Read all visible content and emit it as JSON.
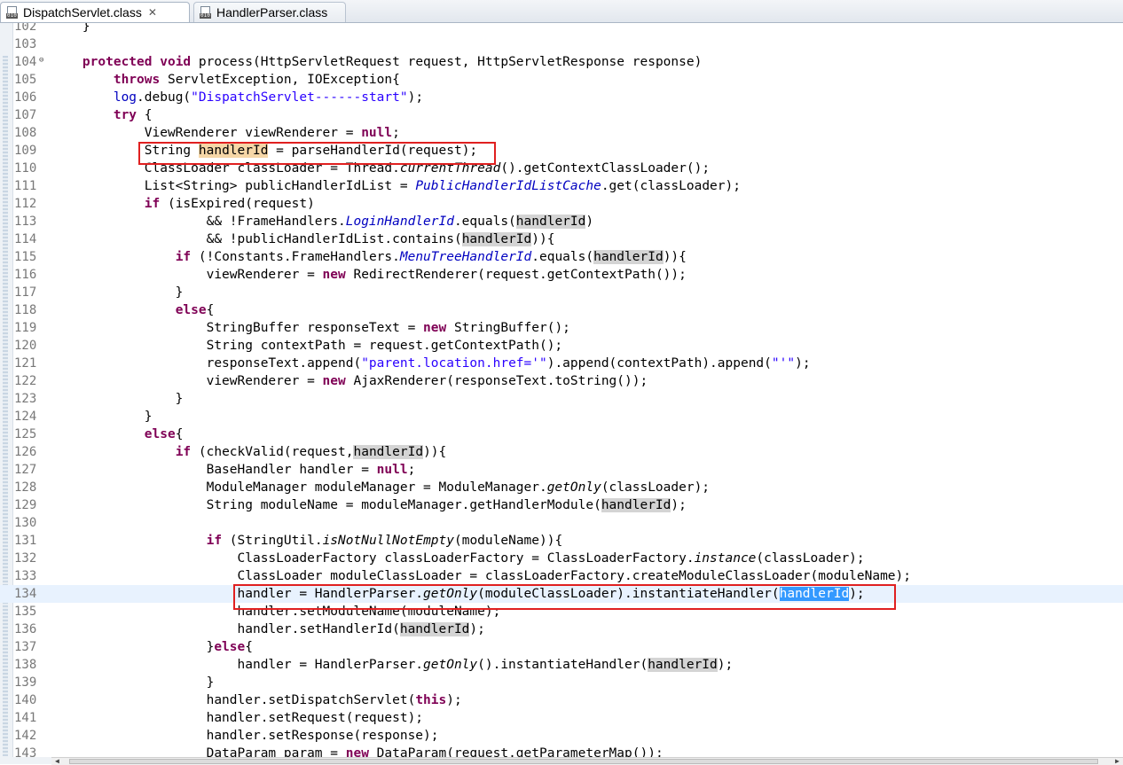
{
  "tabs": [
    {
      "label": "DispatchServlet.class",
      "icon": "class-file-icon",
      "close": "✕"
    },
    {
      "label": "HandlerParser.class",
      "icon": "class-file-icon"
    }
  ],
  "colors": {
    "keyword": "#7f0055",
    "string": "#2a00ff",
    "field": "#0000c0",
    "line_number": "#787878",
    "occurrence_highlight": "#d4d4d4",
    "declaration_highlight": "#f6d7a7",
    "selection": "#3399ff",
    "annotation_box": "#e02020"
  },
  "editor": {
    "lines": [
      {
        "n": "102",
        "segs": [
          [
            "    }",
            ""
          ]
        ]
      },
      {
        "n": "103",
        "segs": []
      },
      {
        "n": "104",
        "fold": true,
        "segs": [
          [
            "    ",
            ""
          ],
          [
            "protected",
            "kw"
          ],
          [
            " ",
            ""
          ],
          [
            "void",
            "kw"
          ],
          [
            " process(HttpServletRequest request, HttpServletResponse response)",
            ""
          ]
        ]
      },
      {
        "n": "105",
        "segs": [
          [
            "        ",
            ""
          ],
          [
            "throws",
            "kw"
          ],
          [
            " ServletException, IOException{",
            ""
          ]
        ]
      },
      {
        "n": "106",
        "segs": [
          [
            "        ",
            ""
          ],
          [
            "log",
            "fld"
          ],
          [
            ".debug(",
            ""
          ],
          [
            "\"DispatchServlet------start\"",
            "str"
          ],
          [
            ");",
            ""
          ]
        ]
      },
      {
        "n": "107",
        "segs": [
          [
            "        ",
            ""
          ],
          [
            "try",
            "kw"
          ],
          [
            " {",
            ""
          ]
        ]
      },
      {
        "n": "108",
        "segs": [
          [
            "            ViewRenderer viewRenderer = ",
            ""
          ],
          [
            "null",
            "kw"
          ],
          [
            ";",
            ""
          ]
        ]
      },
      {
        "n": "109",
        "segs": [
          [
            "            String ",
            ""
          ],
          [
            "handlerId",
            "decl"
          ],
          [
            " = parseHandlerId(request);",
            ""
          ]
        ]
      },
      {
        "n": "110",
        "segs": [
          [
            "            ClassLoader classLoader = Thread.",
            ""
          ],
          [
            "currentThread",
            "it"
          ],
          [
            "().getContextClassLoader();",
            ""
          ]
        ]
      },
      {
        "n": "111",
        "segs": [
          [
            "            List<String> publicHandlerIdList = ",
            ""
          ],
          [
            "PublicHandlerIdListCache",
            "it fld"
          ],
          [
            ".get(classLoader);",
            ""
          ]
        ]
      },
      {
        "n": "112",
        "segs": [
          [
            "            ",
            ""
          ],
          [
            "if",
            "kw"
          ],
          [
            " (isExpired(request)",
            ""
          ]
        ]
      },
      {
        "n": "113",
        "segs": [
          [
            "                    && !FrameHandlers.",
            ""
          ],
          [
            "LoginHandlerId",
            "it fld"
          ],
          [
            ".equals(",
            ""
          ],
          [
            "handlerId",
            "occ"
          ],
          [
            ")",
            ""
          ]
        ]
      },
      {
        "n": "114",
        "segs": [
          [
            "                    && !publicHandlerIdList.contains(",
            ""
          ],
          [
            "handlerId",
            "occ"
          ],
          [
            "))",
            ""
          ],
          [
            "{",
            ""
          ]
        ]
      },
      {
        "n": "115",
        "segs": [
          [
            "                ",
            ""
          ],
          [
            "if",
            "kw"
          ],
          [
            " (!Constants.FrameHandlers.",
            ""
          ],
          [
            "MenuTreeHandlerId",
            "it fld"
          ],
          [
            ".equals(",
            ""
          ],
          [
            "handlerId",
            "occ"
          ],
          [
            ")){",
            ""
          ]
        ]
      },
      {
        "n": "116",
        "segs": [
          [
            "                    viewRenderer = ",
            ""
          ],
          [
            "new",
            "kw"
          ],
          [
            " RedirectRenderer(request.getContextPath());",
            ""
          ]
        ]
      },
      {
        "n": "117",
        "segs": [
          [
            "                }",
            ""
          ]
        ]
      },
      {
        "n": "118",
        "segs": [
          [
            "                ",
            ""
          ],
          [
            "else",
            "kw"
          ],
          [
            "{",
            ""
          ]
        ]
      },
      {
        "n": "119",
        "segs": [
          [
            "                    StringBuffer responseText = ",
            ""
          ],
          [
            "new",
            "kw"
          ],
          [
            " StringBuffer();",
            ""
          ]
        ]
      },
      {
        "n": "120",
        "segs": [
          [
            "                    String contextPath = request.getContextPath();",
            ""
          ]
        ]
      },
      {
        "n": "121",
        "segs": [
          [
            "                    responseText.append(",
            ""
          ],
          [
            "\"parent.location.href='\"",
            "str"
          ],
          [
            ").append(contextPath).append(",
            ""
          ],
          [
            "\"'\"",
            "str"
          ],
          [
            ");",
            ""
          ]
        ]
      },
      {
        "n": "122",
        "segs": [
          [
            "                    viewRenderer = ",
            ""
          ],
          [
            "new",
            "kw"
          ],
          [
            " AjaxRenderer(responseText.toString());",
            ""
          ]
        ]
      },
      {
        "n": "123",
        "segs": [
          [
            "                }",
            ""
          ]
        ]
      },
      {
        "n": "124",
        "segs": [
          [
            "            }",
            ""
          ]
        ]
      },
      {
        "n": "125",
        "segs": [
          [
            "            ",
            ""
          ],
          [
            "else",
            "kw"
          ],
          [
            "{",
            ""
          ]
        ]
      },
      {
        "n": "126",
        "segs": [
          [
            "                ",
            ""
          ],
          [
            "if",
            "kw"
          ],
          [
            " (checkValid(request,",
            ""
          ],
          [
            "handlerId",
            "occ"
          ],
          [
            ")){",
            ""
          ]
        ]
      },
      {
        "n": "127",
        "segs": [
          [
            "                    BaseHandler handler = ",
            ""
          ],
          [
            "null",
            "kw"
          ],
          [
            ";",
            ""
          ]
        ]
      },
      {
        "n": "128",
        "segs": [
          [
            "                    ModuleManager moduleManager = ModuleManager.",
            ""
          ],
          [
            "getOnly",
            "it"
          ],
          [
            "(classLoader);",
            ""
          ]
        ]
      },
      {
        "n": "129",
        "segs": [
          [
            "                    String moduleName = moduleManager.getHandlerModule(",
            ""
          ],
          [
            "handlerId",
            "occ"
          ],
          [
            ");",
            ""
          ]
        ]
      },
      {
        "n": "130",
        "segs": []
      },
      {
        "n": "131",
        "segs": [
          [
            "                    ",
            ""
          ],
          [
            "if",
            "kw"
          ],
          [
            " (StringUtil.",
            ""
          ],
          [
            "isNotNullNotEmpty",
            "it"
          ],
          [
            "(moduleName)){",
            ""
          ]
        ]
      },
      {
        "n": "132",
        "segs": [
          [
            "                        ClassLoaderFactory classLoaderFactory = ClassLoaderFactory.",
            ""
          ],
          [
            "instance",
            "it"
          ],
          [
            "(classLoader);",
            ""
          ]
        ]
      },
      {
        "n": "133",
        "segs": [
          [
            "                        ClassLoader moduleClassLoader = classLoaderFactory.createModuleClassLoader(moduleName);",
            ""
          ]
        ]
      },
      {
        "n": "134",
        "current": true,
        "segs": [
          [
            "                        handler = HandlerParser.",
            ""
          ],
          [
            "getOnly",
            "it"
          ],
          [
            "(moduleClassLoader).instantiateHandler(",
            ""
          ],
          [
            "handlerId",
            "sel"
          ],
          [
            ");",
            ""
          ]
        ]
      },
      {
        "n": "135",
        "segs": [
          [
            "                        handler.setModuleName(moduleName);",
            ""
          ]
        ]
      },
      {
        "n": "136",
        "segs": [
          [
            "                        handler.setHandlerId(",
            ""
          ],
          [
            "handlerId",
            "occ"
          ],
          [
            ");",
            ""
          ]
        ]
      },
      {
        "n": "137",
        "segs": [
          [
            "                    }",
            ""
          ],
          [
            "else",
            "kw"
          ],
          [
            "{",
            ""
          ]
        ]
      },
      {
        "n": "138",
        "segs": [
          [
            "                        handler = HandlerParser.",
            ""
          ],
          [
            "getOnly",
            "it"
          ],
          [
            "().instantiateHandler(",
            ""
          ],
          [
            "handlerId",
            "occ"
          ],
          [
            ");",
            ""
          ]
        ]
      },
      {
        "n": "139",
        "segs": [
          [
            "                    }",
            ""
          ]
        ]
      },
      {
        "n": "140",
        "segs": [
          [
            "                    handler.setDispatchServlet(",
            ""
          ],
          [
            "this",
            "kw"
          ],
          [
            ");",
            ""
          ]
        ]
      },
      {
        "n": "141",
        "segs": [
          [
            "                    handler.setRequest(request);",
            ""
          ]
        ]
      },
      {
        "n": "142",
        "segs": [
          [
            "                    handler.setResponse(response);",
            ""
          ]
        ]
      },
      {
        "n": "143",
        "segs": [
          [
            "                    DataParam param = ",
            ""
          ],
          [
            "new",
            "kw"
          ],
          [
            " DataParam(request.getParameterMap());",
            ""
          ]
        ]
      }
    ]
  }
}
